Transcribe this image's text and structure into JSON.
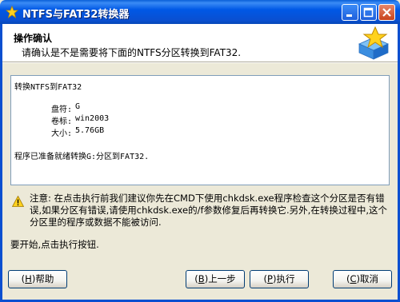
{
  "window": {
    "title": "NTFS与FAT32转换器"
  },
  "header": {
    "title": "操作确认",
    "subtitle": "请确认是不是需要将下面的NTFS分区转换到FAT32."
  },
  "info": {
    "line1": "转换NTFS到FAT32",
    "drive_label": "盘符:",
    "drive_value": "G",
    "volume_label": "卷标:",
    "volume_value": "win2003",
    "size_label": "大小:",
    "size_value": "5.76GB",
    "ready": "程序已准备就绪转换G:分区到FAT32."
  },
  "warning": {
    "text": "注意: 在点击执行前我们建议你先在CMD下使用chkdsk.exe程序检查这个分区是否有错误,如果分区有错误,请使用chkdsk.exe的/f参数修复后再转换它.另外,在转换过程中,这个分区里的程序或数据不能被访问."
  },
  "start_text": "要开始,点击执行按钮.",
  "buttons": {
    "help_key": "H",
    "help_label": "帮助",
    "back_key": "B",
    "back_label": "上一步",
    "run_key": "P",
    "run_label": "执行",
    "cancel_key": "C",
    "cancel_label": "取消"
  }
}
